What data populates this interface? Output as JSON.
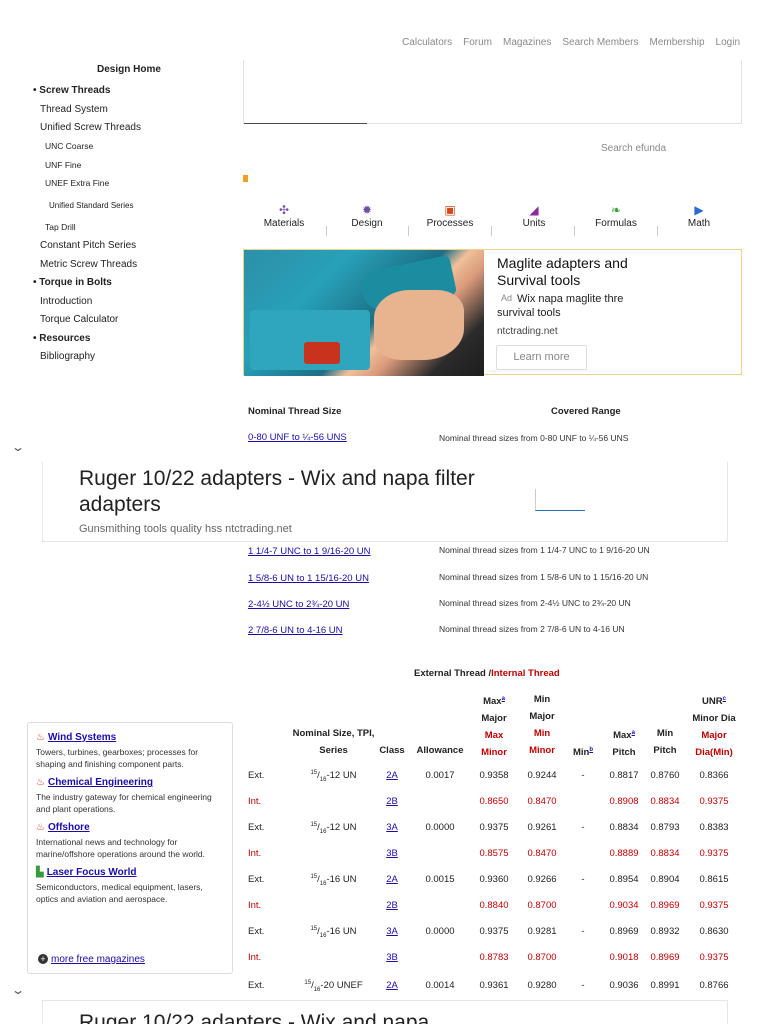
{
  "topnav": [
    "Calculators",
    "Forum",
    "Magazines",
    "Search Members",
    "Membership",
    "Login"
  ],
  "sidebar": {
    "home": "Design Home",
    "items": [
      {
        "label": "• Screw Threads",
        "type": "sec"
      },
      {
        "label": "Thread System",
        "type": "item"
      },
      {
        "label": "Unified Screw Threads",
        "type": "item"
      },
      {
        "label": "UNC Coarse",
        "type": "sub"
      },
      {
        "label": "UNF Fine",
        "type": "sub"
      },
      {
        "label": "UNEF Extra Fine",
        "type": "sub"
      },
      {
        "label": "Unified Standard Series",
        "type": "sub2"
      },
      {
        "label": "Tap Drill",
        "type": "sub"
      },
      {
        "label": "Constant Pitch Series",
        "type": "item"
      },
      {
        "label": "Metric Screw Threads",
        "type": "item"
      },
      {
        "label": "• Torque in Bolts",
        "type": "sec"
      },
      {
        "label": "Introduction",
        "type": "item"
      },
      {
        "label": "Torque Calculator",
        "type": "item"
      },
      {
        "label": "• Resources",
        "type": "sec"
      },
      {
        "label": "Bibliography",
        "type": "item"
      }
    ]
  },
  "search_placeholder": "Search efunda",
  "categories": [
    {
      "label": "Materials",
      "icon": "molecule-icon",
      "color": "#7a4aa8"
    },
    {
      "label": "Design",
      "icon": "gear-icon",
      "color": "#6b4fa0"
    },
    {
      "label": "Processes",
      "icon": "toolbox-icon",
      "color": "#d04a1a"
    },
    {
      "label": "Units",
      "icon": "ruler-icon",
      "color": "#8a2aa0"
    },
    {
      "label": "Formulas",
      "icon": "leaf-icon",
      "color": "#3aa03a"
    },
    {
      "label": "Math",
      "icon": "play-icon",
      "color": "#2a6ad0"
    }
  ],
  "ad_drill": {
    "title": "Maglite adapters and Survival tools",
    "ad_tag": "Ad",
    "desc": "Wix napa maglite thre survival tools",
    "domain": "ntctrading.net",
    "button": "Learn more"
  },
  "thread_table": {
    "col1": "Nominal Thread Size",
    "col2": "Covered Range",
    "rows": [
      {
        "size": "0-80 UNF to ¼-56 UNS",
        "range": "Nominal thread sizes from 0-80 UNF to ¼-56 UNS"
      },
      {
        "size": "1 1/4-7 UNC to 1 9/16-20 UN",
        "range": "Nominal thread sizes from 1 1/4-7 UNC to 1 9/16-20 UN"
      },
      {
        "size": "1 5/8-6 UN to 1 15/16-20 UN",
        "range": "Nominal thread sizes from 1 5/8-6 UN to 1 15/16-20 UN"
      },
      {
        "size": "2-4½ UNC to 2¾-20 UN",
        "range": "Nominal thread sizes from 2-4½ UNC to 2¾-20 UN"
      },
      {
        "size": "2 7/8-6 UN to 4-16 UN",
        "range": "Nominal thread sizes from 2 7/8-6 UN to 4-16 UN"
      }
    ]
  },
  "bottom_ad": {
    "title": "Ruger 10/22 adapters - Wix and napa filter adapters",
    "sub": "Gunsmithing tools quality hss ntctrading.net"
  },
  "bottom_ad2_title": "Ruger 10/22 adapters - Wix and napa",
  "spec": {
    "head_ext": "External Thread /",
    "head_int": "Internal Thread",
    "headers": {
      "nominal": [
        "Nominal Size, TPI,",
        "Series"
      ],
      "class": "Class",
      "allowance": "Allowance",
      "maxmajor": [
        "Max",
        "Major"
      ],
      "maxminor": [
        "Max",
        "Minor"
      ],
      "minmajor": [
        "Min",
        "Major"
      ],
      "minminor": [
        "Min",
        "Minor"
      ],
      "min": "Min",
      "maxpitch": [
        "Max",
        "Pitch"
      ],
      "minpitch": [
        "Min",
        "Pitch"
      ],
      "unr": [
        "UNR",
        "Minor Dia"
      ],
      "majordia": [
        "Major",
        "Dia(Min)"
      ],
      "sup_a": "a",
      "sup_b": "b",
      "sup_c": "c"
    },
    "rows": [
      {
        "type": "Ext.",
        "size_pre": "15",
        "size_den": "16",
        "size_post": "-12 UN",
        "cls": "2A",
        "allow": "0.0017",
        "a": "0.9358",
        "b": "0.9244",
        "c": "-",
        "d": "0.8817",
        "e": "0.8760",
        "f": "0.8366"
      },
      {
        "type": "Int.",
        "size_pre": "",
        "size_den": "",
        "size_post": "",
        "cls": "2B",
        "allow": "",
        "a": "0.8650",
        "b": "0.8470",
        "c": "",
        "d": "0.8908",
        "e": "0.8834",
        "f": "0.9375"
      },
      {
        "type": "Ext.",
        "size_pre": "15",
        "size_den": "16",
        "size_post": "-12 UN",
        "cls": "3A",
        "allow": "0.0000",
        "a": "0.9375",
        "b": "0.9261",
        "c": "-",
        "d": "0.8834",
        "e": "0.8793",
        "f": "0.8383"
      },
      {
        "type": "Int.",
        "size_pre": "",
        "size_den": "",
        "size_post": "",
        "cls": "3B",
        "allow": "",
        "a": "0.8575",
        "b": "0.8470",
        "c": "",
        "d": "0.8889",
        "e": "0.8834",
        "f": "0.9375"
      },
      {
        "type": "Ext.",
        "size_pre": "15",
        "size_den": "16",
        "size_post": "-16 UN",
        "cls": "2A",
        "allow": "0.0015",
        "a": "0.9360",
        "b": "0.9266",
        "c": "-",
        "d": "0.8954",
        "e": "0.8904",
        "f": "0.8615"
      },
      {
        "type": "Int.",
        "size_pre": "",
        "size_den": "",
        "size_post": "",
        "cls": "2B",
        "allow": "",
        "a": "0.8840",
        "b": "0.8700",
        "c": "",
        "d": "0.9034",
        "e": "0.8969",
        "f": "0.9375"
      },
      {
        "type": "Ext.",
        "size_pre": "15",
        "size_den": "16",
        "size_post": "-16 UN",
        "cls": "3A",
        "allow": "0.0000",
        "a": "0.9375",
        "b": "0.9281",
        "c": "-",
        "d": "0.8969",
        "e": "0.8932",
        "f": "0.8630"
      },
      {
        "type": "Int.",
        "size_pre": "",
        "size_den": "",
        "size_post": "",
        "cls": "3B",
        "allow": "",
        "a": "0.8783",
        "b": "0.8700",
        "c": "",
        "d": "0.9018",
        "e": "0.8969",
        "f": "0.9375"
      },
      {
        "type": "Ext.",
        "size_pre": "15",
        "size_den": "16",
        "size_post": "-20 UNEF",
        "cls": "2A",
        "allow": "0.0014",
        "a": "0.9361",
        "b": "0.9280",
        "c": "-",
        "d": "0.9036",
        "e": "0.8991",
        "f": "0.8766"
      }
    ]
  },
  "magazines": [
    {
      "title": "Wind Systems",
      "desc": "Towers, turbines, gearboxes; processes for shaping and finishing component parts.",
      "icon": "flame-icon"
    },
    {
      "title": "Chemical Engineering",
      "desc": "The industry gateway for chemical engineering and plant operations.",
      "icon": "flame-icon"
    },
    {
      "title": "Offshore",
      "desc": "International news and technology for marine/offshore operations around the world.",
      "icon": "flame-icon"
    },
    {
      "title": "Laser Focus World",
      "desc": "Semiconductors, medical equipment, lasers, optics and aviation and aerospace.",
      "icon": "factory-icon"
    }
  ],
  "more_mags": "more free magazines",
  "chevron": "⌄"
}
